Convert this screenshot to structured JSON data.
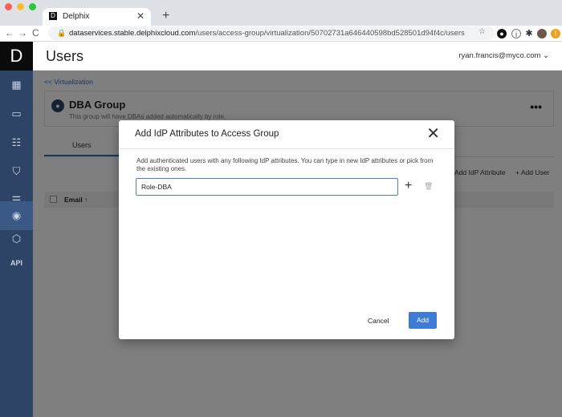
{
  "browser": {
    "tab_title": "Delphix",
    "tab_close": "✕",
    "new_tab": "+",
    "url_host": "dataservices.stable.delphixcloud.com",
    "url_path": "/users/access-group/virtualization/50702731a646440598bd528501d94f4c/users",
    "traffic_colors": [
      "#ff5f57",
      "#febc2e",
      "#28c840"
    ]
  },
  "app": {
    "logo": "D",
    "header_title": "Users",
    "user_menu": "ryan.francis@myco.com",
    "sidebar_api": "API",
    "breadcrumb": "<< Virtualization",
    "group": {
      "name": "DBA Group",
      "description": "This group will have DBAs added automatically by role.",
      "more": "•••"
    },
    "tabs": {
      "users": "Users"
    },
    "actions": {
      "add_idp": "Add IdP Attribute",
      "add_user": "+ Add User"
    },
    "table": {
      "email_header": "Email ↑"
    }
  },
  "modal": {
    "title": "Add IdP Attributes to Access Group",
    "description": "Add authenticated users with any following IdP attributes. You can type in new IdP attributes or pick from the existing ones.",
    "input_value": "Role-DBA",
    "cancel": "Cancel",
    "add": "Add"
  },
  "colors": {
    "sidebar": "#2d4466",
    "accent": "#3d7bd6"
  }
}
